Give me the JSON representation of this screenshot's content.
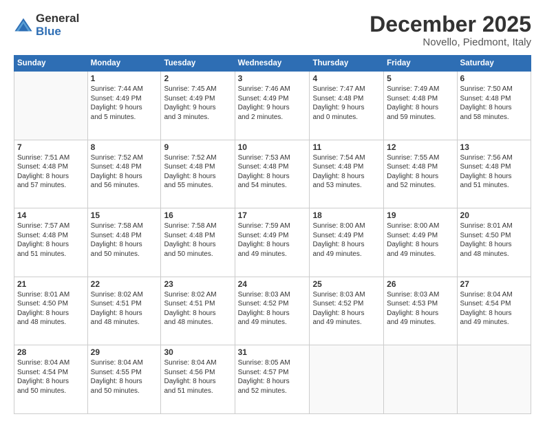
{
  "logo": {
    "general": "General",
    "blue": "Blue"
  },
  "title": "December 2025",
  "location": "Novello, Piedmont, Italy",
  "days_of_week": [
    "Sunday",
    "Monday",
    "Tuesday",
    "Wednesday",
    "Thursday",
    "Friday",
    "Saturday"
  ],
  "weeks": [
    [
      {
        "day": "",
        "info": ""
      },
      {
        "day": "1",
        "info": "Sunrise: 7:44 AM\nSunset: 4:49 PM\nDaylight: 9 hours\nand 5 minutes."
      },
      {
        "day": "2",
        "info": "Sunrise: 7:45 AM\nSunset: 4:49 PM\nDaylight: 9 hours\nand 3 minutes."
      },
      {
        "day": "3",
        "info": "Sunrise: 7:46 AM\nSunset: 4:49 PM\nDaylight: 9 hours\nand 2 minutes."
      },
      {
        "day": "4",
        "info": "Sunrise: 7:47 AM\nSunset: 4:48 PM\nDaylight: 9 hours\nand 0 minutes."
      },
      {
        "day": "5",
        "info": "Sunrise: 7:49 AM\nSunset: 4:48 PM\nDaylight: 8 hours\nand 59 minutes."
      },
      {
        "day": "6",
        "info": "Sunrise: 7:50 AM\nSunset: 4:48 PM\nDaylight: 8 hours\nand 58 minutes."
      }
    ],
    [
      {
        "day": "7",
        "info": "Sunrise: 7:51 AM\nSunset: 4:48 PM\nDaylight: 8 hours\nand 57 minutes."
      },
      {
        "day": "8",
        "info": "Sunrise: 7:52 AM\nSunset: 4:48 PM\nDaylight: 8 hours\nand 56 minutes."
      },
      {
        "day": "9",
        "info": "Sunrise: 7:52 AM\nSunset: 4:48 PM\nDaylight: 8 hours\nand 55 minutes."
      },
      {
        "day": "10",
        "info": "Sunrise: 7:53 AM\nSunset: 4:48 PM\nDaylight: 8 hours\nand 54 minutes."
      },
      {
        "day": "11",
        "info": "Sunrise: 7:54 AM\nSunset: 4:48 PM\nDaylight: 8 hours\nand 53 minutes."
      },
      {
        "day": "12",
        "info": "Sunrise: 7:55 AM\nSunset: 4:48 PM\nDaylight: 8 hours\nand 52 minutes."
      },
      {
        "day": "13",
        "info": "Sunrise: 7:56 AM\nSunset: 4:48 PM\nDaylight: 8 hours\nand 51 minutes."
      }
    ],
    [
      {
        "day": "14",
        "info": "Sunrise: 7:57 AM\nSunset: 4:48 PM\nDaylight: 8 hours\nand 51 minutes."
      },
      {
        "day": "15",
        "info": "Sunrise: 7:58 AM\nSunset: 4:48 PM\nDaylight: 8 hours\nand 50 minutes."
      },
      {
        "day": "16",
        "info": "Sunrise: 7:58 AM\nSunset: 4:48 PM\nDaylight: 8 hours\nand 50 minutes."
      },
      {
        "day": "17",
        "info": "Sunrise: 7:59 AM\nSunset: 4:49 PM\nDaylight: 8 hours\nand 49 minutes."
      },
      {
        "day": "18",
        "info": "Sunrise: 8:00 AM\nSunset: 4:49 PM\nDaylight: 8 hours\nand 49 minutes."
      },
      {
        "day": "19",
        "info": "Sunrise: 8:00 AM\nSunset: 4:49 PM\nDaylight: 8 hours\nand 49 minutes."
      },
      {
        "day": "20",
        "info": "Sunrise: 8:01 AM\nSunset: 4:50 PM\nDaylight: 8 hours\nand 48 minutes."
      }
    ],
    [
      {
        "day": "21",
        "info": "Sunrise: 8:01 AM\nSunset: 4:50 PM\nDaylight: 8 hours\nand 48 minutes."
      },
      {
        "day": "22",
        "info": "Sunrise: 8:02 AM\nSunset: 4:51 PM\nDaylight: 8 hours\nand 48 minutes."
      },
      {
        "day": "23",
        "info": "Sunrise: 8:02 AM\nSunset: 4:51 PM\nDaylight: 8 hours\nand 48 minutes."
      },
      {
        "day": "24",
        "info": "Sunrise: 8:03 AM\nSunset: 4:52 PM\nDaylight: 8 hours\nand 49 minutes."
      },
      {
        "day": "25",
        "info": "Sunrise: 8:03 AM\nSunset: 4:52 PM\nDaylight: 8 hours\nand 49 minutes."
      },
      {
        "day": "26",
        "info": "Sunrise: 8:03 AM\nSunset: 4:53 PM\nDaylight: 8 hours\nand 49 minutes."
      },
      {
        "day": "27",
        "info": "Sunrise: 8:04 AM\nSunset: 4:54 PM\nDaylight: 8 hours\nand 49 minutes."
      }
    ],
    [
      {
        "day": "28",
        "info": "Sunrise: 8:04 AM\nSunset: 4:54 PM\nDaylight: 8 hours\nand 50 minutes."
      },
      {
        "day": "29",
        "info": "Sunrise: 8:04 AM\nSunset: 4:55 PM\nDaylight: 8 hours\nand 50 minutes."
      },
      {
        "day": "30",
        "info": "Sunrise: 8:04 AM\nSunset: 4:56 PM\nDaylight: 8 hours\nand 51 minutes."
      },
      {
        "day": "31",
        "info": "Sunrise: 8:05 AM\nSunset: 4:57 PM\nDaylight: 8 hours\nand 52 minutes."
      },
      {
        "day": "",
        "info": ""
      },
      {
        "day": "",
        "info": ""
      },
      {
        "day": "",
        "info": ""
      }
    ]
  ]
}
